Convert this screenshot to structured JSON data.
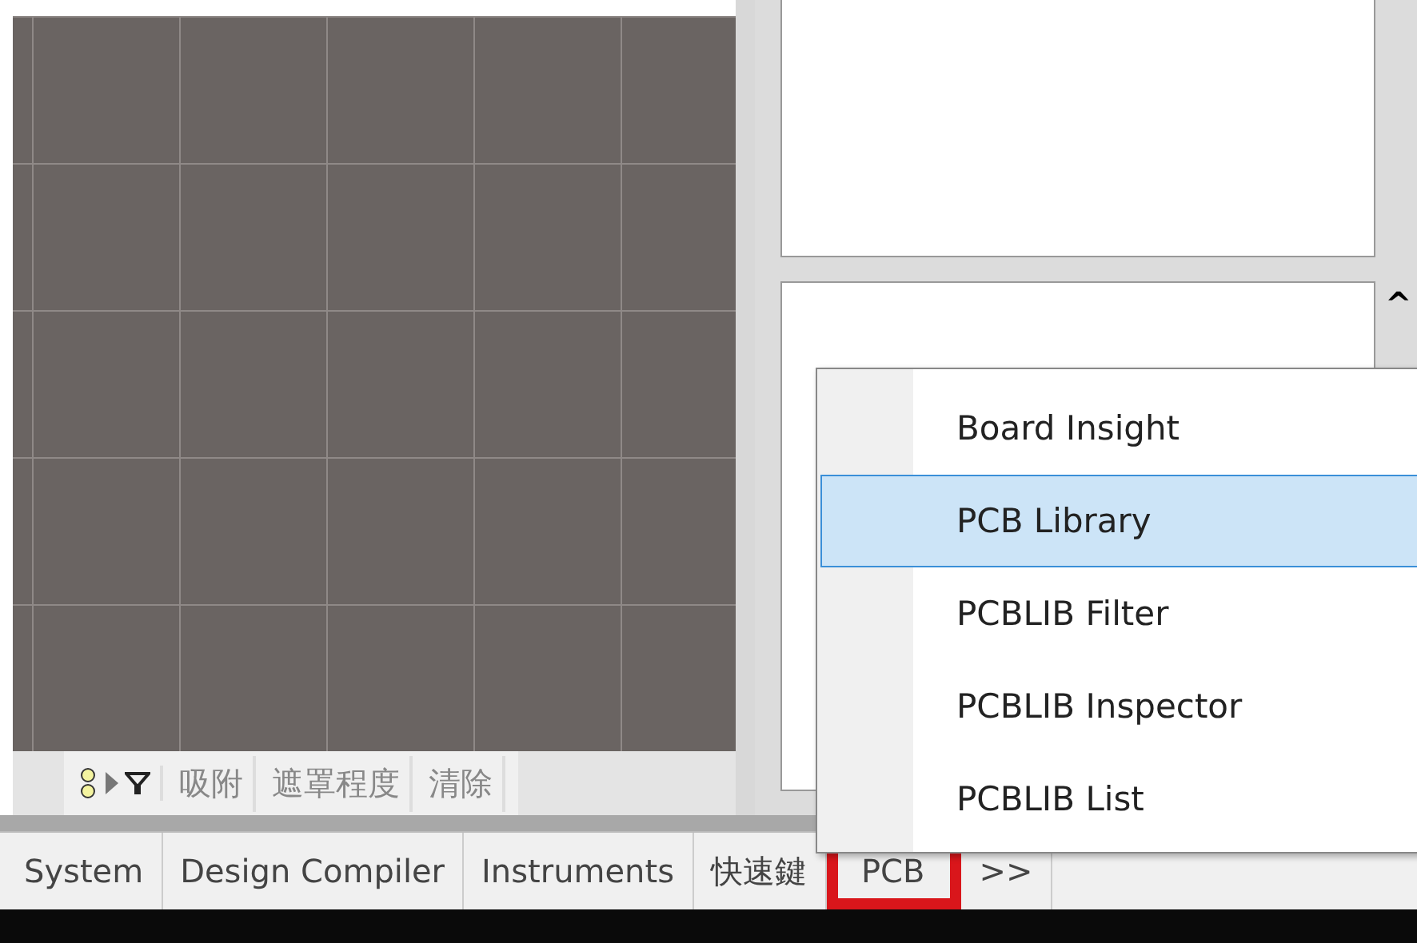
{
  "canvas_toolbar": {
    "items": [
      {
        "kind": "icon-group"
      },
      {
        "kind": "text",
        "label": "吸附"
      },
      {
        "kind": "text",
        "label": "遮罩程度"
      },
      {
        "kind": "text",
        "label": "清除"
      }
    ]
  },
  "panel": {
    "scroll_up": "^"
  },
  "menu": {
    "items": [
      {
        "label": "Board Insight",
        "selected": false
      },
      {
        "label": "PCB Library",
        "selected": true
      },
      {
        "label": "PCBLIB Filter",
        "selected": false
      },
      {
        "label": "PCBLIB Inspector",
        "selected": false
      },
      {
        "label": "PCBLIB List",
        "selected": false
      }
    ]
  },
  "tabs": [
    {
      "label": "System",
      "highlighted": false
    },
    {
      "label": "Design Compiler",
      "highlighted": false
    },
    {
      "label": "Instruments",
      "highlighted": false
    },
    {
      "label": "快速鍵",
      "highlighted": false
    },
    {
      "label": "PCB",
      "highlighted": true
    },
    {
      "label": ">>",
      "highlighted": false
    }
  ]
}
